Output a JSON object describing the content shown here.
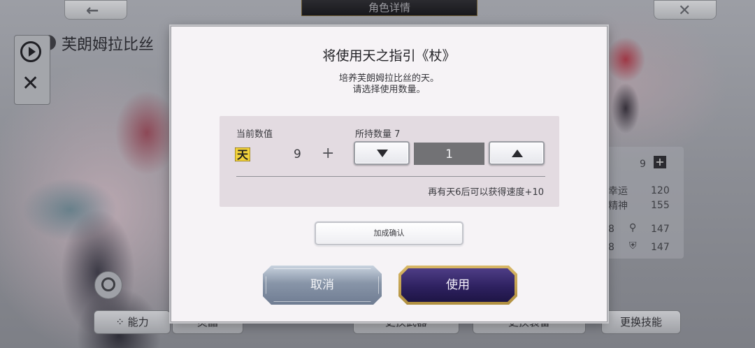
{
  "background": {
    "title": "角色详情",
    "character_name": "芙朗姆拉比丝",
    "stats": [
      {
        "label": "幸运",
        "value": "120"
      },
      {
        "label": "精神",
        "value": "155"
      }
    ],
    "level_value": "9",
    "stat_rows": [
      {
        "left": "8",
        "value": "147"
      },
      {
        "left": "8",
        "value": "147"
      }
    ],
    "bottom_buttons": [
      "能力",
      "灵晶",
      "更换武器",
      "更换装备",
      "更换技能"
    ]
  },
  "dialog": {
    "title": "将使用天之指引《杖》",
    "desc_line1": "培养芙朗姆拉比丝的天。",
    "desc_line2": "请选择使用数量。",
    "current_label": "当前数值",
    "owned_label": "所持数量 7",
    "icon_char": "天",
    "current_value": "9",
    "plus": "+",
    "quantity": "1",
    "bonus_text": "再有天6后可以获得速度+10",
    "confirm_label": "加成确认",
    "cancel_label": "取消",
    "use_label": "使用"
  },
  "colors": {
    "use_button": "#2e2160",
    "cancel_button": "#8895a8",
    "quantity_field": "#727275"
  }
}
